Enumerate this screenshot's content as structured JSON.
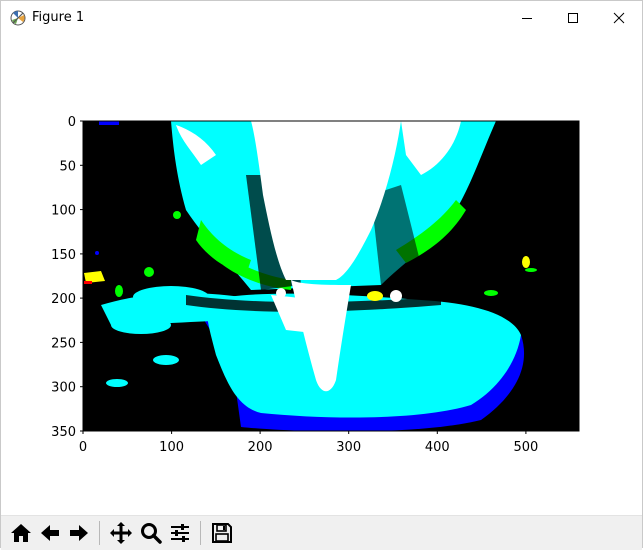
{
  "window": {
    "title": "Figure 1",
    "icon": "matplotlib-logo-icon",
    "controls": [
      "minimize-icon",
      "maximize-icon",
      "close-icon"
    ]
  },
  "toolbar": {
    "buttons": [
      {
        "name": "home-button",
        "icon": "home-icon"
      },
      {
        "name": "back-button",
        "icon": "arrow-left-icon"
      },
      {
        "name": "forward-button",
        "icon": "arrow-right-icon"
      },
      {
        "name": "pan-button",
        "icon": "move-arrows-icon"
      },
      {
        "name": "zoom-button",
        "icon": "magnifier-icon"
      },
      {
        "name": "configure-subplots-button",
        "icon": "sliders-icon"
      },
      {
        "name": "save-button",
        "icon": "floppy-disk-icon"
      }
    ]
  },
  "chart_data": {
    "type": "heatmap",
    "title": "",
    "xlabel": "",
    "ylabel": "",
    "xlim": [
      0,
      560
    ],
    "ylim": [
      350,
      0
    ],
    "x_ticks": [
      "0",
      "100",
      "200",
      "300",
      "400",
      "500"
    ],
    "y_ticks": [
      "0",
      "50",
      "100",
      "150",
      "200",
      "250",
      "300",
      "350"
    ],
    "colors": {
      "background": "#000000",
      "cyan": "#00ffff",
      "white": "#ffffff",
      "green": "#00ff00",
      "yellow": "#ffff00",
      "blue": "#0000ff",
      "red": "#ff0000"
    }
  }
}
